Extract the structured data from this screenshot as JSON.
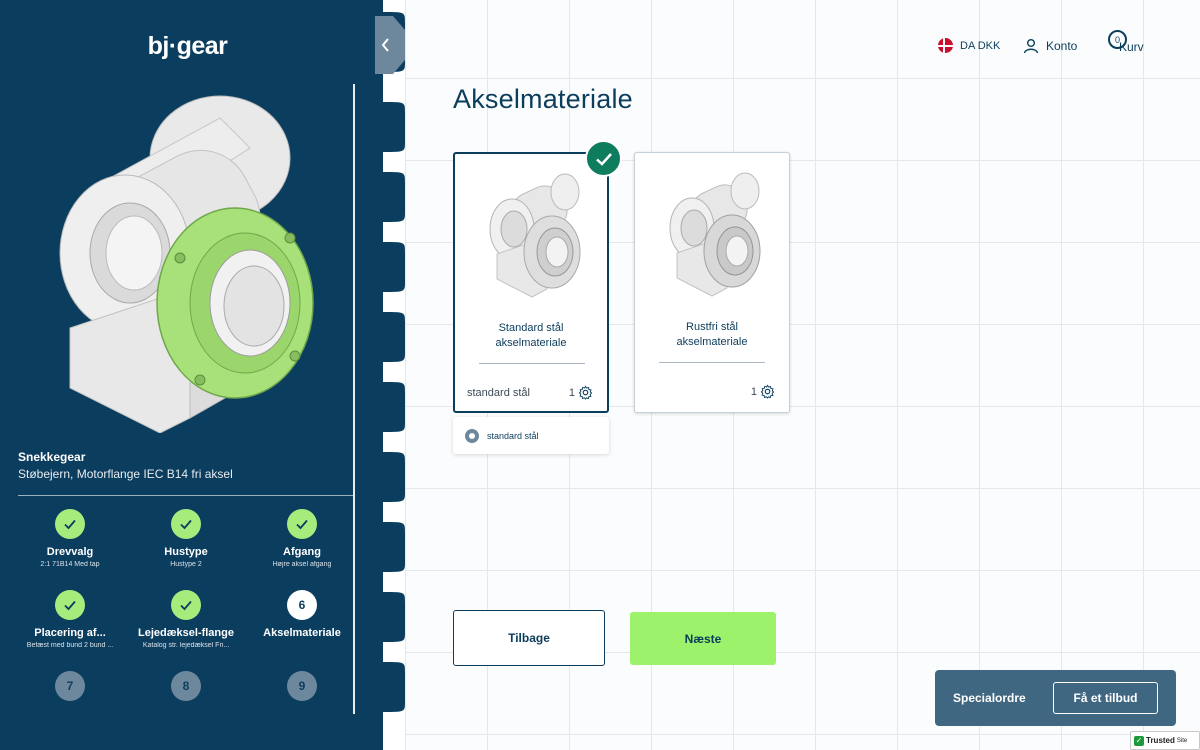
{
  "sidebar": {
    "logo": "bj·gear",
    "product": {
      "title": "Snekkegear",
      "subtitle": "Støbejern, Motorflange IEC B14 fri aksel"
    },
    "steps": [
      {
        "status": "done",
        "number": "",
        "label": "Drevvalg",
        "detail": "2:1 71B14 Med tap"
      },
      {
        "status": "done",
        "number": "",
        "label": "Hustype",
        "detail": "Hustype 2"
      },
      {
        "status": "done",
        "number": "",
        "label": "Afgang",
        "detail": "Højre aksel afgang"
      },
      {
        "status": "done",
        "number": "",
        "label": "Placering af...",
        "detail": "Befæst med bund 2 bund ..."
      },
      {
        "status": "done",
        "number": "",
        "label": "Lejedæksel-flange",
        "detail": "Katalog str. lejedæksel Fri..."
      },
      {
        "status": "current",
        "number": "6",
        "label": "Akselmateriale",
        "detail": ""
      },
      {
        "status": "pending",
        "number": "7",
        "label": "",
        "detail": ""
      },
      {
        "status": "pending",
        "number": "8",
        "label": "",
        "detail": ""
      },
      {
        "status": "pending",
        "number": "9",
        "label": "",
        "detail": ""
      }
    ]
  },
  "header": {
    "language": "DA DKK",
    "account": "Konto",
    "cart_count": "0",
    "cart": "Kurv"
  },
  "main": {
    "title": "Akselmateriale",
    "options": [
      {
        "title_line1": "Standard stål",
        "title_line2": "akselmateriale",
        "material": "standard stål",
        "qty": "1",
        "selected": true
      },
      {
        "title_line1": "Rustfri stål",
        "title_line2": "akselmateriale",
        "material": "",
        "qty": "1",
        "selected": false
      }
    ],
    "selected_option_label": "standard stål",
    "back_label": "Tilbage",
    "next_label": "Næste"
  },
  "special": {
    "label": "Specialordre",
    "quote_label": "Få et tilbud"
  },
  "trusted": {
    "brand": "Trusted",
    "suffix": "Site"
  },
  "colors": {
    "sidebar": "#0b3d5f",
    "accent_green": "#9cf26a",
    "check_green": "#0e7d5d",
    "text_navy": "#0b3d5c"
  }
}
